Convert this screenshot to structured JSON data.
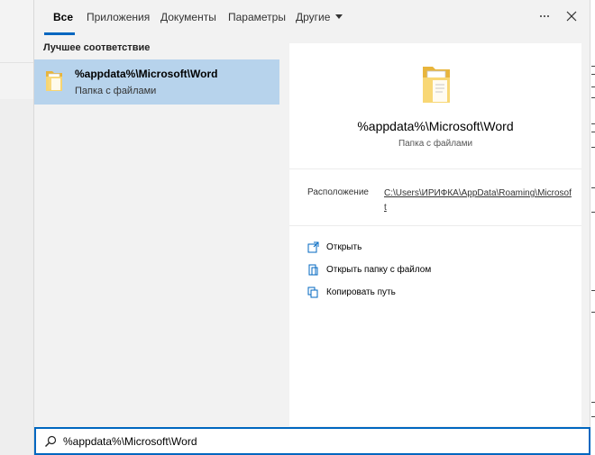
{
  "tabs": [
    {
      "label": "Все",
      "active": true
    },
    {
      "label": "Приложения"
    },
    {
      "label": "Документы"
    },
    {
      "label": "Параметры"
    },
    {
      "label": "Другие",
      "dropdown": true
    }
  ],
  "header_icons": {
    "more": "more-options-icon",
    "close": "close-icon"
  },
  "results": {
    "section_label": "Лучшее соответствие",
    "best_match": {
      "title": "%appdata%\\Microsoft\\Word",
      "subtitle": "Папка с файлами",
      "icon": "folder-icon"
    }
  },
  "detail": {
    "title": "%appdata%\\Microsoft\\Word",
    "subtitle": "Папка с файлами",
    "location_label": "Расположение",
    "location_value": "C:\\Users\\ИРИФКА\\AppData\\Roaming\\Microsoft",
    "actions": [
      {
        "label": "Открыть",
        "icon": "open-icon"
      },
      {
        "label": "Открыть папку с файлом",
        "icon": "open-folder-location-icon"
      },
      {
        "label": "Копировать путь",
        "icon": "copy-path-icon"
      }
    ]
  },
  "search": {
    "value": "%appdata%\\Microsoft\\Word",
    "icon": "search-icon"
  },
  "colors": {
    "accent": "#0067c0",
    "selection": "#b7d3ec",
    "folder": "#f8d775"
  }
}
